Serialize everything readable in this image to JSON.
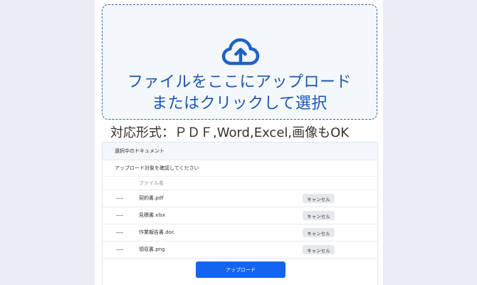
{
  "dropzone": {
    "line1": "ファイルをここにアップロード",
    "line2": "またはクリックして選択",
    "icon": "cloud-upload-icon",
    "color": "#1a57b3"
  },
  "formats_text": "対応形式：ＰＤＦ,Word,Excel,画像もOK",
  "panel": {
    "header": "選択中のドキュメント",
    "subheader": "アップロード対象を確認してください",
    "column_filename": "ファイル名",
    "files": [
      {
        "name": "契約書.pdf",
        "action": "キャンセル"
      },
      {
        "name": "見積書.xlsx",
        "action": "キャンセル"
      },
      {
        "name": "作業報告書.doc",
        "action": "キャンセル"
      },
      {
        "name": "領収書.png",
        "action": "キャンセル"
      }
    ],
    "upload_label": "アップロード",
    "accent": "#1464f0"
  }
}
